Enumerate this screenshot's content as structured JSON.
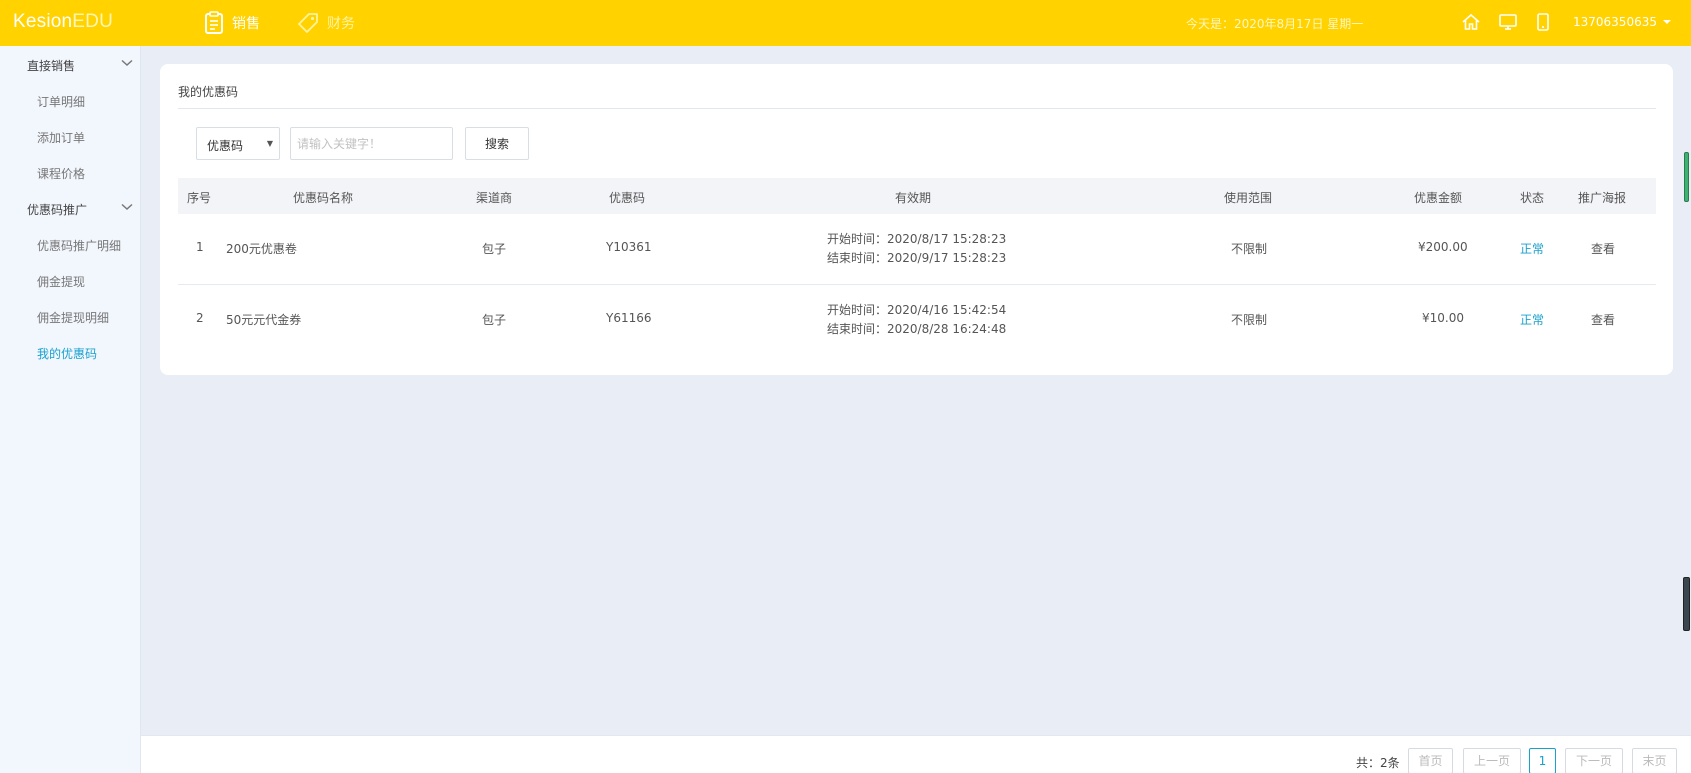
{
  "header": {
    "logo_main": "Kesion",
    "logo_accent": "EDU",
    "nav": [
      {
        "label": "销售",
        "icon": "clipboard-icon",
        "active": true
      },
      {
        "label": "财务",
        "icon": "tag-icon",
        "active": false
      }
    ],
    "today": "今天是：2020年8月17日 星期一",
    "icons": [
      "home-icon",
      "monitor-icon",
      "mobile-icon"
    ],
    "user": "13706350635",
    "colors": {
      "bar": "#ffd200"
    }
  },
  "sidebar": {
    "groups": [
      {
        "label": "直接销售",
        "items": [
          "订单明细",
          "添加订单",
          "课程价格"
        ]
      },
      {
        "label": "优惠码推广",
        "items": [
          "优惠码推广明细",
          "佣金提现",
          "佣金提现明细",
          "我的优惠码"
        ]
      }
    ],
    "active_item": "我的优惠码",
    "colors": {
      "active": "#1aa1ce"
    }
  },
  "main": {
    "title": "我的优惠码",
    "filter": {
      "select_value": "优惠码",
      "input_placeholder": "请输入关键字！",
      "search_label": "搜索"
    },
    "columns": [
      "序号",
      "优惠码名称",
      "渠道商",
      "优惠码",
      "有效期",
      "使用范围",
      "优惠金额",
      "状态",
      "推广海报"
    ],
    "rows": [
      {
        "index": "1",
        "name": "200元优惠卷",
        "channel": "包子",
        "code": "Y10361",
        "start": "开始时间：2020/8/17 15:28:23",
        "end": "结束时间：2020/9/17 15:28:23",
        "scope": "不限制",
        "amount": "¥200.00",
        "status": "正常",
        "poster": "查看"
      },
      {
        "index": "2",
        "name": "50元元代金券",
        "channel": "包子",
        "code": "Y61166",
        "start": "开始时间：2020/4/16 15:42:54",
        "end": "结束时间：2020/8/28 16:24:48",
        "scope": "不限制",
        "amount": "¥10.00",
        "status": "正常",
        "poster": "查看"
      }
    ]
  },
  "pagination": {
    "total": "共：2条",
    "first": "首页",
    "prev": "上一页",
    "current": "1",
    "next": "下一页",
    "last": "末页"
  }
}
